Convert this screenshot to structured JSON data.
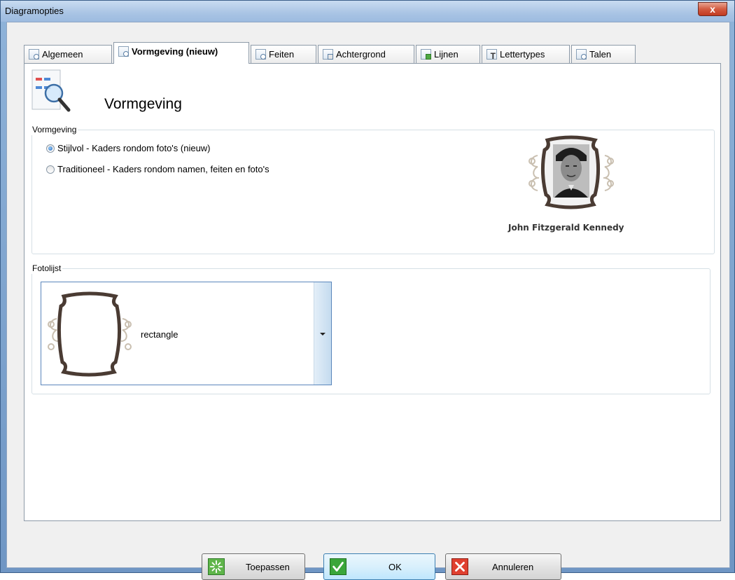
{
  "window": {
    "title": "Diagramopties",
    "close_glyph": "x"
  },
  "tabs": [
    {
      "label": "Algemeen",
      "icon": "gear-page-icon",
      "active": false
    },
    {
      "label": "Vormgeving (nieuw)",
      "icon": "magnifier-page-icon",
      "active": true
    },
    {
      "label": "Feiten",
      "icon": "clock-page-icon",
      "active": false
    },
    {
      "label": "Achtergrond",
      "icon": "background-page-icon",
      "active": false
    },
    {
      "label": "Lijnen",
      "icon": "lines-page-icon",
      "active": false
    },
    {
      "label": "Lettertypes",
      "icon": "font-page-icon",
      "active": false
    },
    {
      "label": "Talen",
      "icon": "globe-page-icon",
      "active": false
    }
  ],
  "page": {
    "title": "Vormgeving",
    "icon": "chart-magnifier-icon"
  },
  "vormgeving_group": {
    "legend": "Vormgeving",
    "options": [
      {
        "label": "Stijlvol - Kaders rondom foto's (nieuw)",
        "checked": true
      },
      {
        "label": "Traditioneel - Kaders rondom namen, feiten en foto's",
        "checked": false
      }
    ],
    "preview_name": "John Fitzgerald Kennedy"
  },
  "fotolijst_group": {
    "legend": "Fotolijst",
    "selected": "rectangle"
  },
  "buttons": {
    "apply": "Toepassen",
    "ok": "OK",
    "cancel": "Annuleren"
  },
  "colors": {
    "frame_brown": "#4a3b33",
    "ornament_beige": "#c9bfb0",
    "ok_green": "#3aa63a",
    "cancel_red": "#e04030"
  }
}
